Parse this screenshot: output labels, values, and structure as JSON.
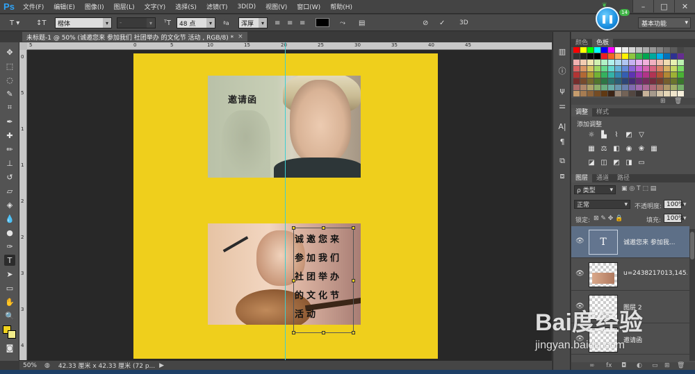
{
  "app": {
    "logo": "Ps",
    "menu": [
      "文件(F)",
      "编辑(E)",
      "图像(I)",
      "图层(L)",
      "文字(Y)",
      "选择(S)",
      "滤镜(T)",
      "3D(D)",
      "视图(V)",
      "窗口(W)",
      "帮助(H)"
    ],
    "window_controls": [
      "–",
      "□",
      "✕"
    ]
  },
  "options": {
    "font_family": "楷体",
    "font_style": "-",
    "font_size": "48 点",
    "antialias_icon": "ªa",
    "antialias": "浑厚",
    "workspace": "基本功能",
    "mode_3d": "3D"
  },
  "document_tab": {
    "title": "未标题-1 @ 50% (诚邀您来 参加我们 社团举办 的文化节 活动 , RGB/8) *",
    "close": "×"
  },
  "rulers": {
    "top": [
      "5",
      "0",
      "5",
      "10",
      "15",
      "20",
      "25",
      "30",
      "35",
      "40",
      "45"
    ],
    "left": [
      "0",
      "5",
      "1",
      "1",
      "2",
      "2",
      "3",
      "3",
      "4"
    ]
  },
  "canvas": {
    "invite_title": "邀请函",
    "poem_lines": [
      "诚邀您来",
      "参加我们",
      "社团举办",
      "的文化节",
      "活动"
    ]
  },
  "status": {
    "zoom": "50%",
    "doc_info": "42.33 厘米 x 42.33 厘米 (72 p...",
    "arrow": "▶"
  },
  "panels": {
    "color_tabs": [
      "颜色",
      "色板"
    ],
    "adjust_tabs": [
      "调整",
      "样式"
    ],
    "adjust_label": "添加调整",
    "layers_tabs": [
      "图层",
      "通道",
      "路径"
    ],
    "filter_kind": "ρ 类型",
    "blend_mode": "正常",
    "opacity_label": "不透明度:",
    "opacity": "100%",
    "lock_label": "锁定:",
    "fill_label": "填充:",
    "fill": "100%",
    "layers": [
      {
        "name": "诚邀您来 参加我...",
        "thumb": "T",
        "selected": true
      },
      {
        "name": "u=2438217013,145...",
        "thumb": "",
        "selected": false
      },
      {
        "name": "图层 2",
        "thumb": "",
        "selected": false
      },
      {
        "name": "邀请函",
        "thumb": "",
        "selected": false
      }
    ]
  },
  "widget": {
    "badge": "14",
    "pause": "❚❚"
  },
  "watermark": {
    "logo": "Bai度经验",
    "url": "jingyan.baidu.com"
  },
  "colors": {
    "document_bg": "#efcf1c",
    "guide": "#3ccfd2",
    "selected_layer": "#5d6f87",
    "foreground": "#f0d21e",
    "background": "#f2ec8a"
  }
}
